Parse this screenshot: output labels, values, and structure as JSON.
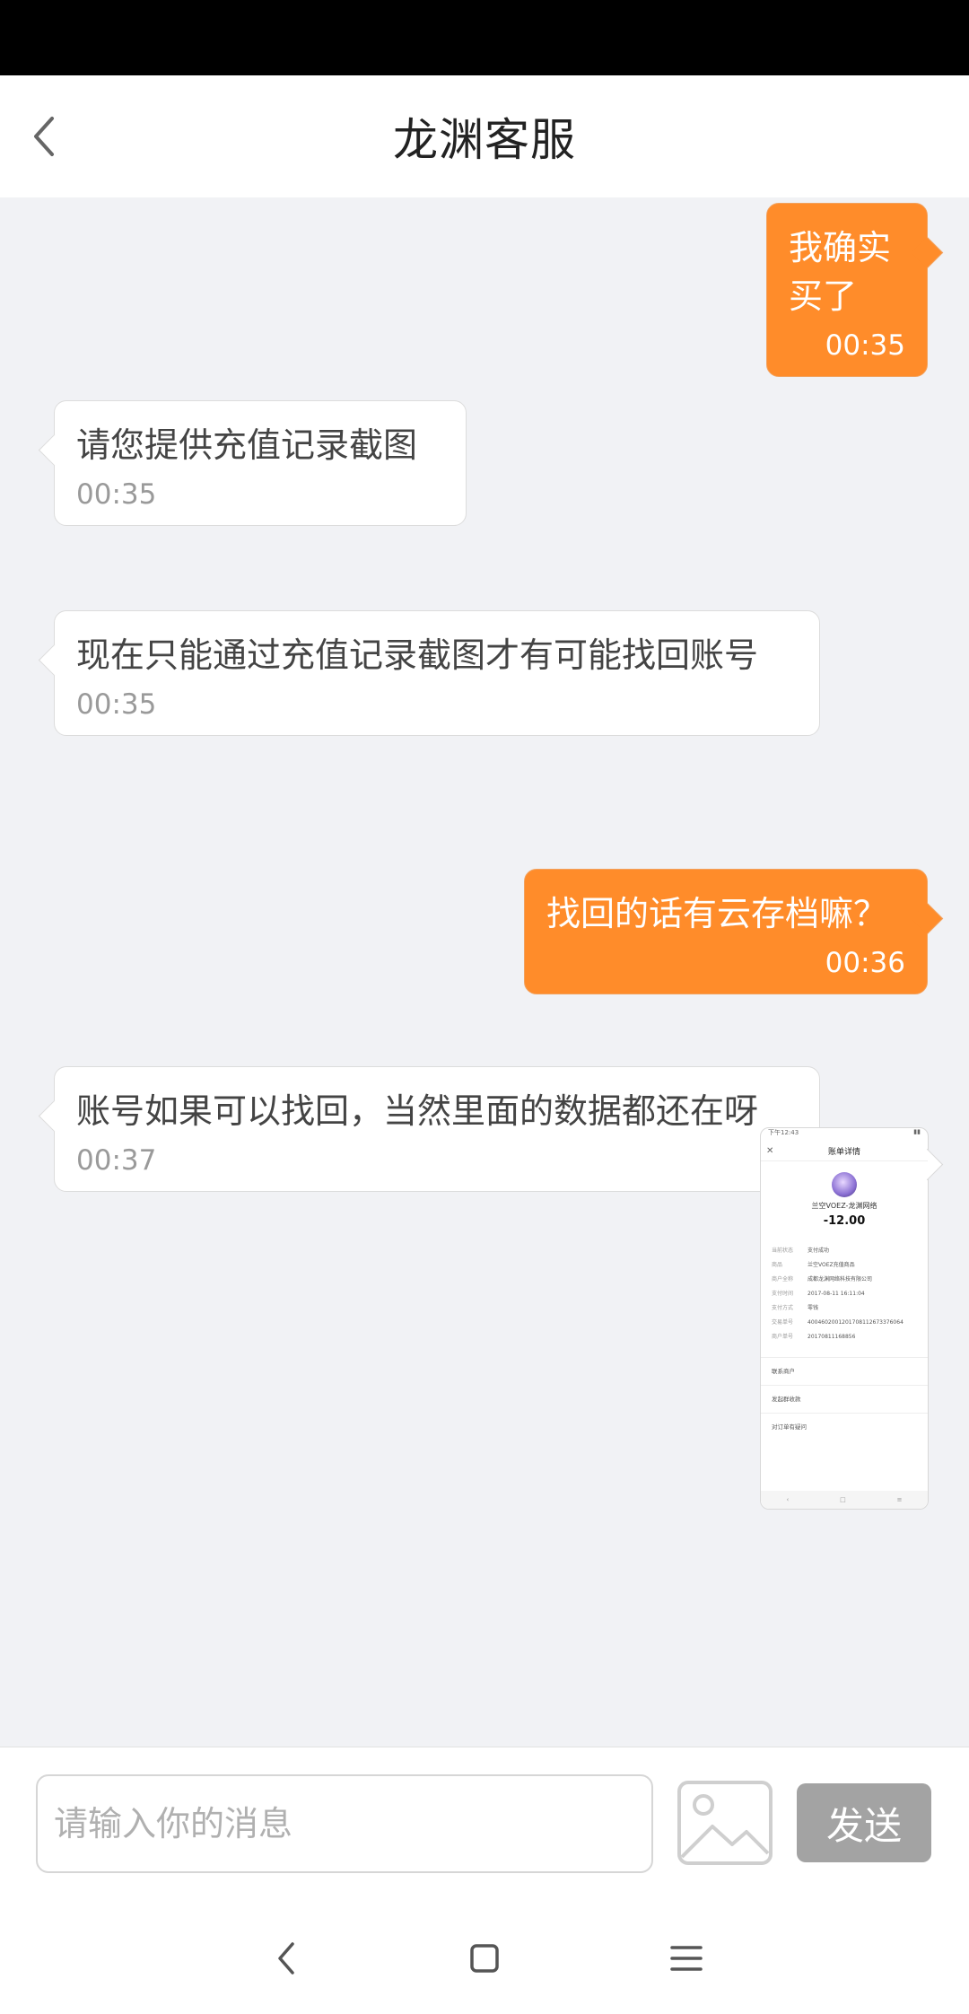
{
  "header": {
    "title": "龙渊客服"
  },
  "messages": [
    {
      "direction": "out",
      "text": "我确实买了",
      "time": "00:35"
    },
    {
      "direction": "in",
      "text": "请您提供充值记录截图",
      "time": "00:35"
    },
    {
      "direction": "in",
      "text": "现在只能通过充值记录截图才有可能找回账号",
      "time": "00:35"
    },
    {
      "direction": "out",
      "text": "找回的话有云存档嘛？",
      "time": "00:36"
    },
    {
      "direction": "in",
      "text": "账号如果可以找回，当然里面的数据都还在呀",
      "time": "00:37"
    }
  ],
  "image_message": {
    "status_time": "下午12:43",
    "title": "账单详情",
    "merchant": "兰空VOEZ-龙渊网络",
    "amount": "-12.00",
    "rows": [
      {
        "k": "当前状态",
        "v": "支付成功"
      },
      {
        "k": "商品",
        "v": "兰空VOEZ充值商品"
      },
      {
        "k": "商户全称",
        "v": "成都龙渊网络科技有限公司"
      },
      {
        "k": "支付时间",
        "v": "2017-08-11 16:11:04"
      },
      {
        "k": "支付方式",
        "v": "零钱"
      },
      {
        "k": "交易单号",
        "v": "4004602001201708112673376064"
      },
      {
        "k": "商户单号",
        "v": "20170811168856"
      }
    ],
    "sections": [
      "联系商户",
      "发起群收款",
      "对订单有疑问"
    ]
  },
  "input": {
    "placeholder": "请输入你的消息",
    "value": ""
  },
  "send_button": {
    "label": "发送"
  },
  "colors": {
    "accent": "#ff8c2a",
    "send_disabled": "#a3a3a3",
    "background": "#f1f2f5"
  }
}
